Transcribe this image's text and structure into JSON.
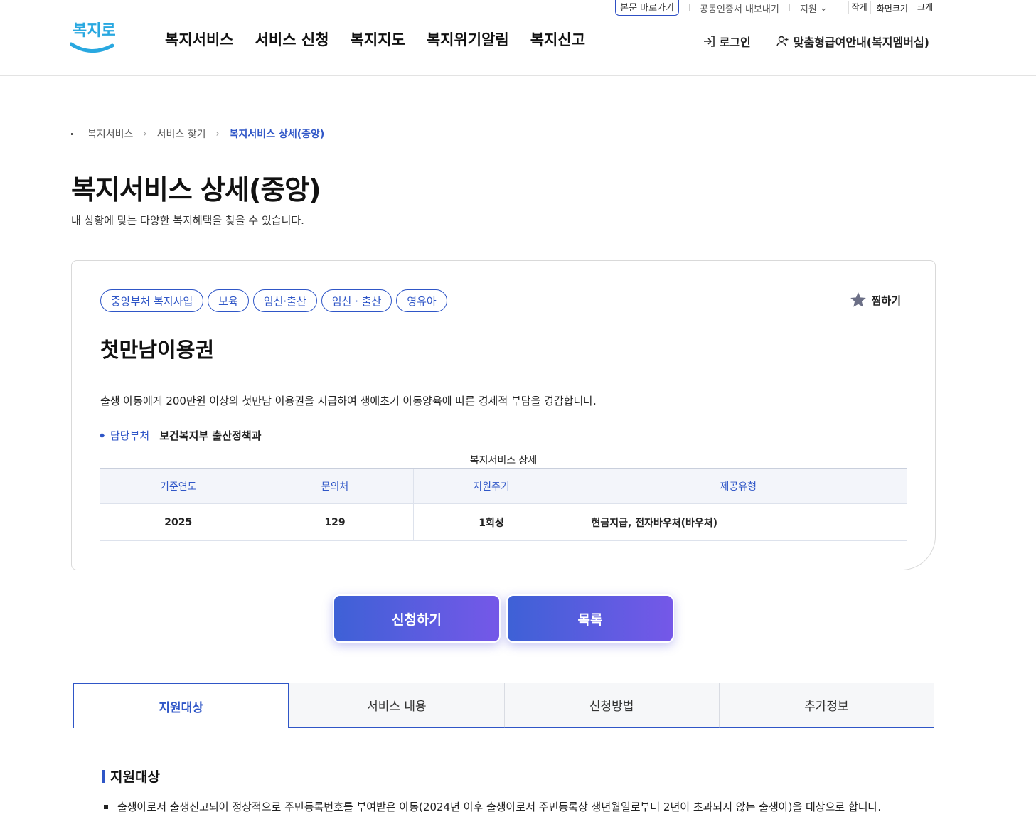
{
  "util": {
    "skip": "본문 바로가기",
    "cert": "공동인증서 내보내기",
    "lang": "지원",
    "size_small": "작게",
    "size_label": "화면크기",
    "size_large": "크게"
  },
  "header": {
    "logo_text": "복지로",
    "nav": [
      "복지서비스",
      "서비스 신청",
      "복지지도",
      "복지위기알림",
      "복지신고"
    ],
    "login": "로그인",
    "membership": "맞춤형급여안내(복지멤버십)"
  },
  "breadcrumb": [
    "복지서비스",
    "서비스 찾기",
    "복지서비스 상세(중앙)"
  ],
  "page": {
    "title": "복지서비스 상세(중앙)",
    "desc": "내 상황에 맞는 다양한 복지혜택을 찾을 수 있습니다."
  },
  "service": {
    "tags": [
      "중앙부처 복지사업",
      "보육",
      "임신·출산",
      "임신 · 출산",
      "영유아"
    ],
    "fav_label": "찜하기",
    "title": "첫만남이용권",
    "desc": "출생 아동에게 200만원 이상의 첫만남 이용권을 지급하여 생애초기 아동양육에 따른 경제적 부담을 경감합니다.",
    "dept_label": "담당부처",
    "dept_value": "보건복지부 출산정책과",
    "table_caption": "복지서비스 상세",
    "table_headers": [
      "기준연도",
      "문의처",
      "지원주기",
      "제공유형"
    ],
    "table_values": [
      "2025",
      "129",
      "1회성",
      "현금지급, 전자바우처(바우처)"
    ]
  },
  "buttons": {
    "apply": "신청하기",
    "list": "목록"
  },
  "tabs": [
    "지원대상",
    "서비스 내용",
    "신청방법",
    "추가정보"
  ],
  "content": {
    "section_title": "지원대상",
    "bullet": "출생아로서 출생신고되어 정상적으로 주민등록번호를 부여받은 아동(2024년 이후 출생아로서 주민등록상 생년월일로부터 2년이 초과되지 않는 출생아)을 대상으로 합니다."
  },
  "colors": {
    "accent": "#2f56c7",
    "button_from": "#3e61d6",
    "button_to": "#7558e8",
    "logo": "#29a8e0"
  }
}
